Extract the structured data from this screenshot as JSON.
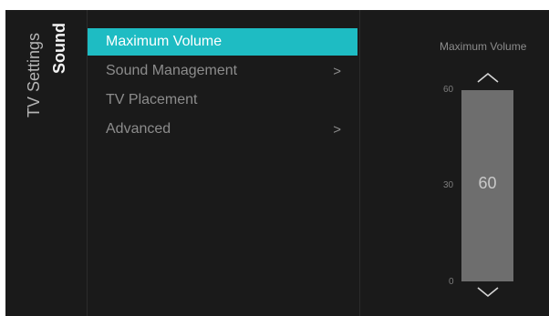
{
  "breadcrumb": {
    "parent": "TV Settings",
    "current": "Sound"
  },
  "menu": {
    "items": [
      {
        "label": "Maximum Volume",
        "selected": true,
        "has_submenu": false
      },
      {
        "label": "Sound Management",
        "selected": false,
        "has_submenu": true,
        "chevron": ">"
      },
      {
        "label": "TV Placement",
        "selected": false,
        "has_submenu": false
      },
      {
        "label": "Advanced",
        "selected": false,
        "has_submenu": true,
        "chevron": ">"
      }
    ]
  },
  "slider": {
    "title": "Maximum Volume",
    "tick_labels": {
      "max": "60",
      "mid": "30",
      "min": "0"
    },
    "value_label": "60",
    "value": 60,
    "min": 0,
    "max": 60,
    "up_icon": "chevron-up-icon",
    "down_icon": "chevron-down-icon"
  },
  "colors": {
    "background": "#1a1a1a",
    "selected_item": "#1ebcc3",
    "slider_fill": "#6e6e6e",
    "slider_track": "#3a3a3a",
    "inactive_text": "#8c8c8c"
  }
}
